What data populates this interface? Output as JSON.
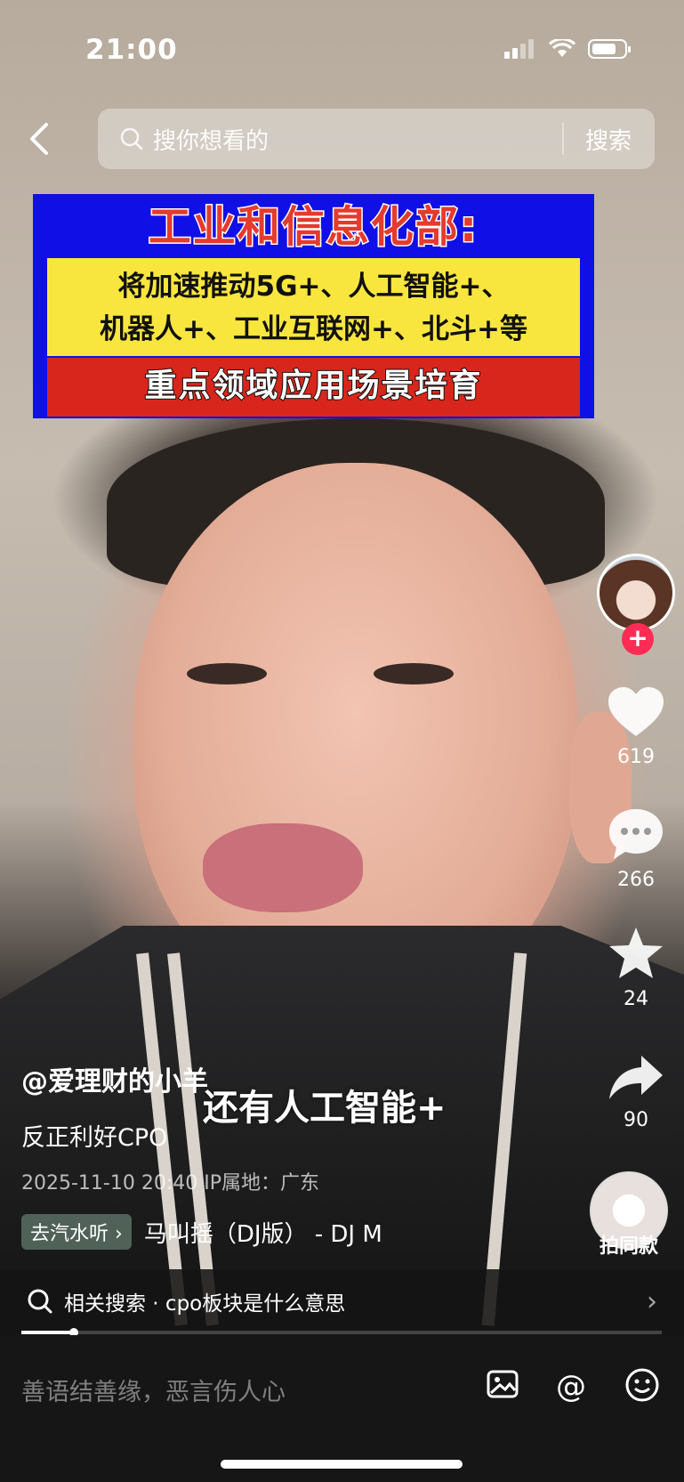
{
  "status_bar": {
    "time": "21:00"
  },
  "search": {
    "placeholder": "搜你想看的",
    "button": "搜索"
  },
  "banner": {
    "title": "工业和信息化部:",
    "line1": "将加速推动5G+、人工智能+、",
    "line2": "机器人+、工业互联网+、北斗+等",
    "line3": "重点领域应用场景培育"
  },
  "rail": {
    "likes": "619",
    "comments": "266",
    "favorites": "24",
    "shares": "90",
    "same_style": "拍同款"
  },
  "post": {
    "author": "@爱理财的小羊",
    "description": "反正利好CPO",
    "meta": "2025-11-10 20:40  IP属地：广东",
    "subtitle": "还有人工智能+",
    "music_tag": "去汽水听",
    "music_name": "马叫摇（DJ版） - DJ M"
  },
  "related": {
    "text": "相关搜索 · cpo板块是什么意思"
  },
  "comment": {
    "placeholder": "善语结善缘，恶言伤人心"
  },
  "progress": 0.08,
  "colors": {
    "accent": "#fe2c55",
    "banner_blue": "#1010e6",
    "banner_yellow": "#f8e63e",
    "banner_red": "#d8261c"
  }
}
